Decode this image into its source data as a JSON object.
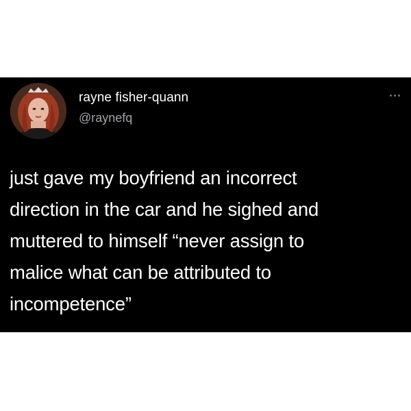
{
  "tweet": {
    "author": {
      "display_name": "rayne fisher-quann",
      "handle": "@raynefq",
      "avatar_icon": "profile-photo"
    },
    "more_icon": "more-horizontal-icon",
    "body_lines": [
      "just gave my boyfriend an incorrect",
      "direction in the car and he sighed and",
      "muttered to himself “never assign to",
      "malice what can be attributed to",
      "incompetence”"
    ]
  },
  "colors": {
    "page_background": "#ffffff",
    "tweet_background": "#000000",
    "text_primary": "#ffffff",
    "text_secondary": "#a0a4a8"
  }
}
